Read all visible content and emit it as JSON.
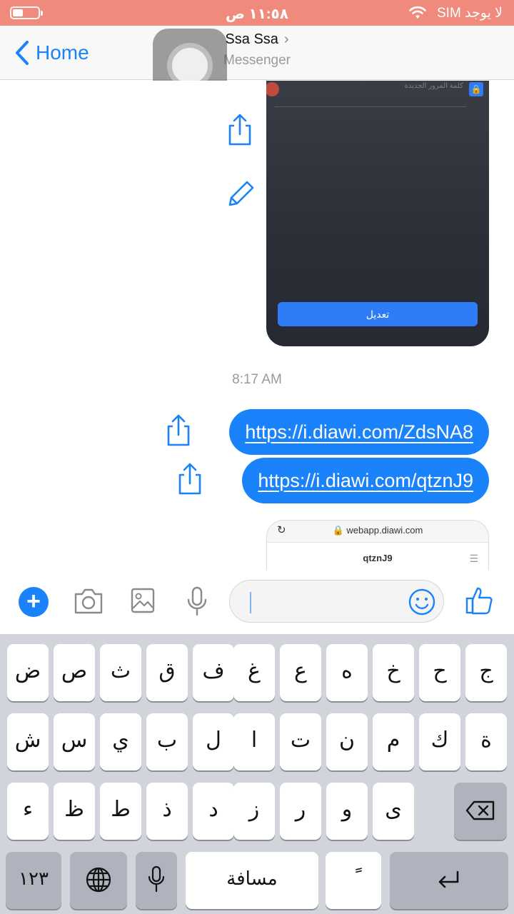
{
  "status_bar": {
    "carrier": "لا يوجد SIM",
    "time": "١١:٥٨ ص"
  },
  "nav": {
    "back_label": "Home",
    "title": "Ssa Ssa",
    "subtitle": "Messenger"
  },
  "chat": {
    "image_message": {
      "header_label": "كلمة المرور الجديدة",
      "button_label": "تعديل"
    },
    "timestamp": "8:17 AM",
    "messages": [
      {
        "text": "https://i.diawi.com/ZdsNA8"
      },
      {
        "text": "https://i.diawi.com/qtznJ9"
      }
    ],
    "link_preview": {
      "url": "webapp.diawi.com",
      "name": "qtznJ9"
    }
  },
  "composer": {
    "icons": [
      "add-icon",
      "camera-icon",
      "photo-icon",
      "microphone-icon",
      "emoji-icon",
      "thumbs-up-icon"
    ]
  },
  "keyboard": {
    "row1": [
      "ج",
      "ح",
      "خ",
      "ه",
      "ع",
      "غ",
      "ف",
      "ق",
      "ث",
      "ص",
      "ض"
    ],
    "row2": [
      "ة",
      "ك",
      "م",
      "ن",
      "ت",
      "ا",
      "ل",
      "ب",
      "ي",
      "س",
      "ش"
    ],
    "row3": [
      "ى",
      "و",
      "ر",
      "ز",
      "د",
      "ذ",
      "ط",
      "ظ",
      "ء"
    ],
    "numbers_label": "١٢٣",
    "space_label": "مسافة",
    "diacritic_label": "ً",
    "accent_color": "#1a82fb"
  }
}
